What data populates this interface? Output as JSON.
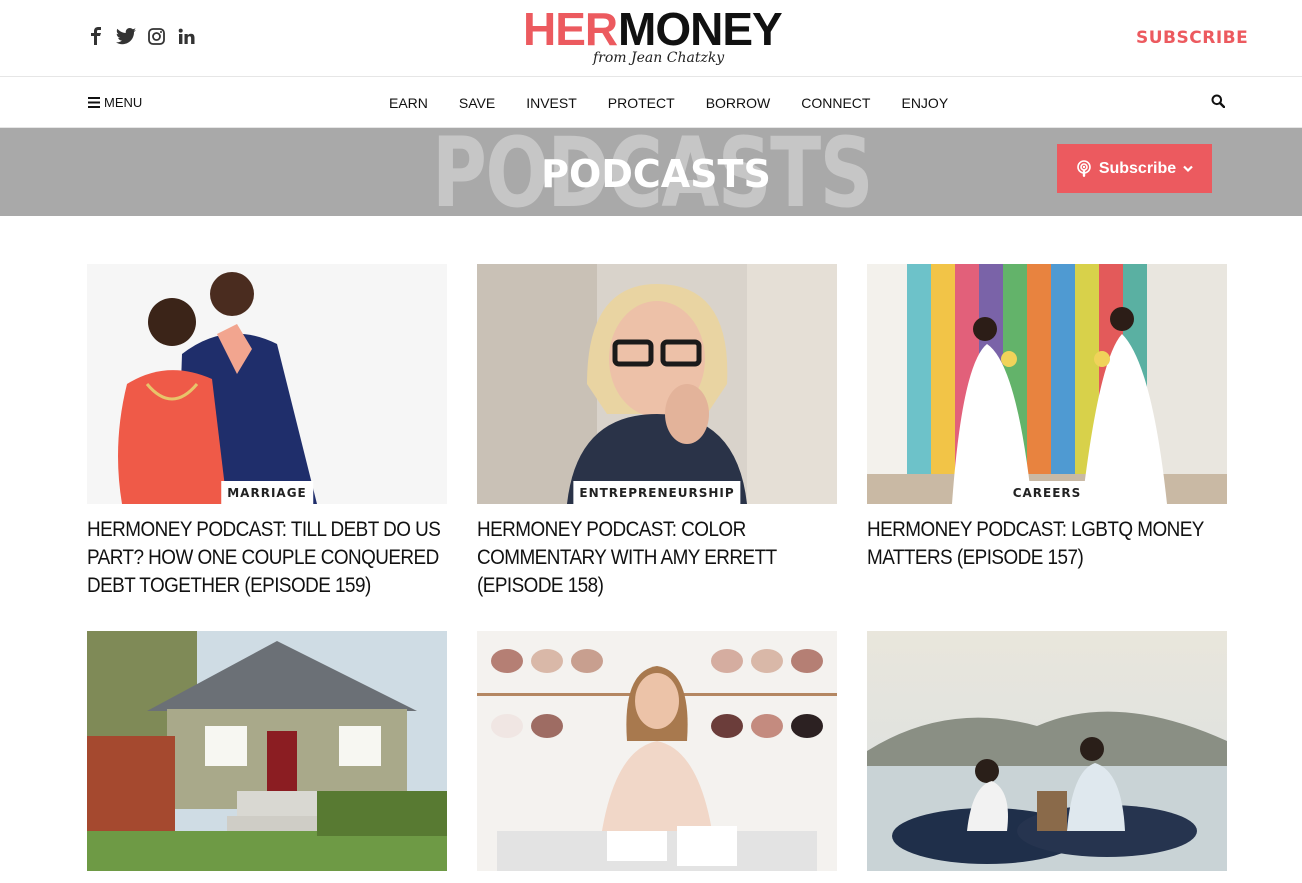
{
  "header": {
    "social": [
      {
        "icon": "facebook-icon"
      },
      {
        "icon": "twitter-icon"
      },
      {
        "icon": "instagram-icon"
      },
      {
        "icon": "linkedin-icon"
      }
    ],
    "logo": {
      "her": "HER",
      "money": "MONEY",
      "tagline": "from Jean Chatzky"
    },
    "subscribe_label": "SUBSCRIBE"
  },
  "nav": {
    "menu_label": "MENU",
    "items": [
      "EARN",
      "SAVE",
      "INVEST",
      "PROTECT",
      "BORROW",
      "CONNECT",
      "ENJOY"
    ]
  },
  "hero": {
    "background_text": "PODCASTS",
    "title": "PODCASTS",
    "subscribe_label": "Subscribe"
  },
  "cards": [
    {
      "category": "MARRIAGE",
      "title": "HerMoney Podcast: Till Debt Do Us Part? How One Couple Conquered Debt Together (Episode 159)"
    },
    {
      "category": "ENTREPRENEURSHIP",
      "title": "HerMoney Podcast: Color Commentary With Amy Errett (Episode 158)"
    },
    {
      "category": "CAREERS",
      "title": "HerMoney Podcast: LGBTQ Money Matters (Episode 157)"
    },
    {
      "category": "",
      "title": ""
    },
    {
      "category": "",
      "title": ""
    },
    {
      "category": "",
      "title": ""
    }
  ],
  "colors": {
    "accent": "#ec5a5f",
    "hero_bg": "#a9a9a9"
  }
}
